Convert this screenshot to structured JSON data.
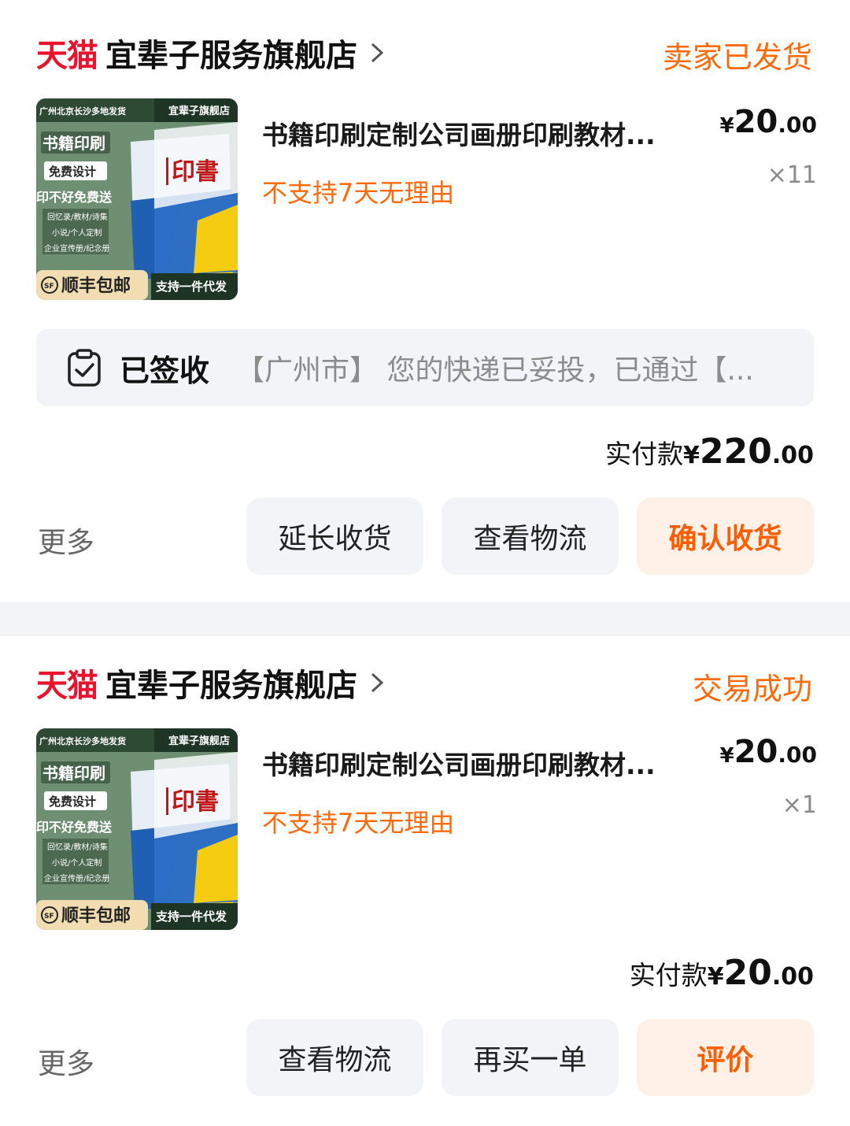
{
  "orders": [
    {
      "tmall_logo": "天猫",
      "shop_name": "宜辈子服务旗舰店",
      "status": "卖家已发货",
      "item": {
        "title": "书籍印刷定制公司画册印刷教材...",
        "policy": "不支持7天无理由",
        "price": {
          "currency": "¥",
          "int": "20",
          "dec": ".00"
        },
        "quantity": "×11",
        "thumb": {
          "top_left": "广州北京长沙多地发货",
          "top_right": "宜辈子旗舰店",
          "t1": "书籍印刷",
          "t2": "免费设计",
          "t3": "印不好免费送",
          "s1": "回忆录/教材/诗集",
          "s2": "小说/个人定制",
          "s3": "企业宣传册/纪念册",
          "sf_badge": "SF",
          "sf_text": "顺丰包邮",
          "support": "支持一件代发",
          "book_title": "印書"
        }
      },
      "logistics": {
        "status": "已签收",
        "text": "【广州市】 您的快递已妥投，已通过【..."
      },
      "paid": {
        "label": "实付款",
        "currency": "¥",
        "int": "220",
        "dec": ".00"
      },
      "more": "更多",
      "buttons": [
        "延长收货",
        "查看物流",
        "确认收货"
      ]
    },
    {
      "tmall_logo": "天猫",
      "shop_name": "宜辈子服务旗舰店",
      "status": "交易成功",
      "item": {
        "title": "书籍印刷定制公司画册印刷教材...",
        "policy": "不支持7天无理由",
        "price": {
          "currency": "¥",
          "int": "20",
          "dec": ".00"
        },
        "quantity": "×1",
        "thumb": {
          "top_left": "广州北京长沙多地发货",
          "top_right": "宜辈子旗舰店",
          "t1": "书籍印刷",
          "t2": "免费设计",
          "t3": "印不好免费送",
          "s1": "回忆录/教材/诗集",
          "s2": "小说/个人定制",
          "s3": "企业宣传册/纪念册",
          "sf_badge": "SF",
          "sf_text": "顺丰包邮",
          "support": "支持一件代发",
          "book_title": "印書"
        }
      },
      "paid": {
        "label": "实付款",
        "currency": "¥",
        "int": "20",
        "dec": ".00"
      },
      "more": "更多",
      "buttons": [
        "查看物流",
        "再买一单",
        "评价"
      ]
    }
  ],
  "colors": {
    "accent": "#ff6a0a",
    "tmall_red": "#e8132d",
    "button_bg": "#f2f4f8",
    "primary_bg": "#fff1e8"
  }
}
